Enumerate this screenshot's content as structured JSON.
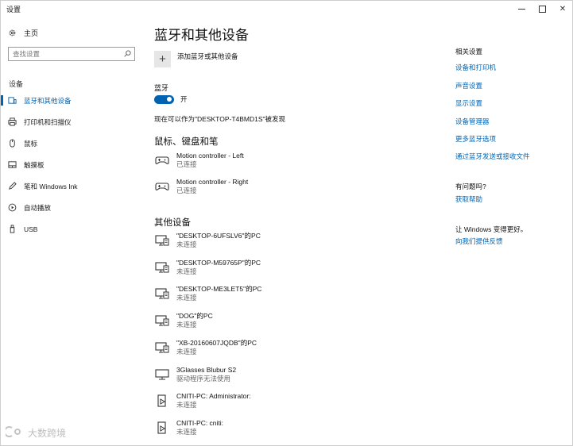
{
  "window": {
    "title": "设置"
  },
  "sidebar": {
    "home_label": "主页",
    "search_placeholder": "查找设置",
    "section_label": "设备",
    "items": [
      {
        "label": "蓝牙和其他设备",
        "icon": "bluetooth-devices-icon",
        "active": true
      },
      {
        "label": "打印机和扫描仪",
        "icon": "printer-icon"
      },
      {
        "label": "鼠标",
        "icon": "mouse-icon"
      },
      {
        "label": "触摸板",
        "icon": "touchpad-icon"
      },
      {
        "label": "笔和 Windows Ink",
        "icon": "pen-icon"
      },
      {
        "label": "自动播放",
        "icon": "autoplay-icon"
      },
      {
        "label": "USB",
        "icon": "usb-icon"
      }
    ]
  },
  "main": {
    "title": "蓝牙和其他设备",
    "add_device_label": "添加蓝牙或其他设备",
    "bluetooth_label": "蓝牙",
    "bluetooth_toggle_state": "开",
    "discoverable_text": "现在可以作为\"DESKTOP-T4BMD1S\"被发现",
    "mouse_section": {
      "heading": "鼠标、键盘和笔",
      "devices": [
        {
          "name": "Motion controller - Left",
          "status": "已连接",
          "icon": "gamepad-icon"
        },
        {
          "name": "Motion controller - Right",
          "status": "已连接",
          "icon": "gamepad-icon"
        }
      ]
    },
    "other_section": {
      "heading": "其他设备",
      "devices": [
        {
          "name": "\"DESKTOP-6UFSLV6\"的PC",
          "status": "未连接",
          "icon": "pc-network-icon"
        },
        {
          "name": "\"DESKTOP-M59765P\"的PC",
          "status": "未连接",
          "icon": "pc-network-icon"
        },
        {
          "name": "\"DESKTOP-ME3LET5\"的PC",
          "status": "未连接",
          "icon": "pc-network-icon"
        },
        {
          "name": "\"DOG\"的PC",
          "status": "未连接",
          "icon": "pc-network-icon"
        },
        {
          "name": "\"XB-20160607JQDB\"的PC",
          "status": "未连接",
          "icon": "pc-network-icon"
        },
        {
          "name": "3Glasses Blubur S2",
          "status": "驱动程序无法使用",
          "icon": "monitor-icon"
        },
        {
          "name": "CNITI-PC: Administrator:",
          "status": "未连接",
          "icon": "media-device-icon"
        },
        {
          "name": "CNITI-PC: cniti:",
          "status": "未连接",
          "icon": "media-device-icon"
        }
      ]
    }
  },
  "related": {
    "heading": "相关设置",
    "links": [
      "设备和打印机",
      "声音设置",
      "显示设置",
      "设备管理器",
      "更多蓝牙选项",
      "通过蓝牙发送或接收文件"
    ],
    "help_heading": "有问题吗?",
    "help_link": "获取帮助",
    "feedback_heading": "让 Windows 变得更好。",
    "feedback_link": "向我们提供反馈"
  },
  "watermark": {
    "text": "大数跨境"
  },
  "colors": {
    "accent": "#0063b1",
    "text": "#1a1a1a",
    "muted": "#666666"
  }
}
